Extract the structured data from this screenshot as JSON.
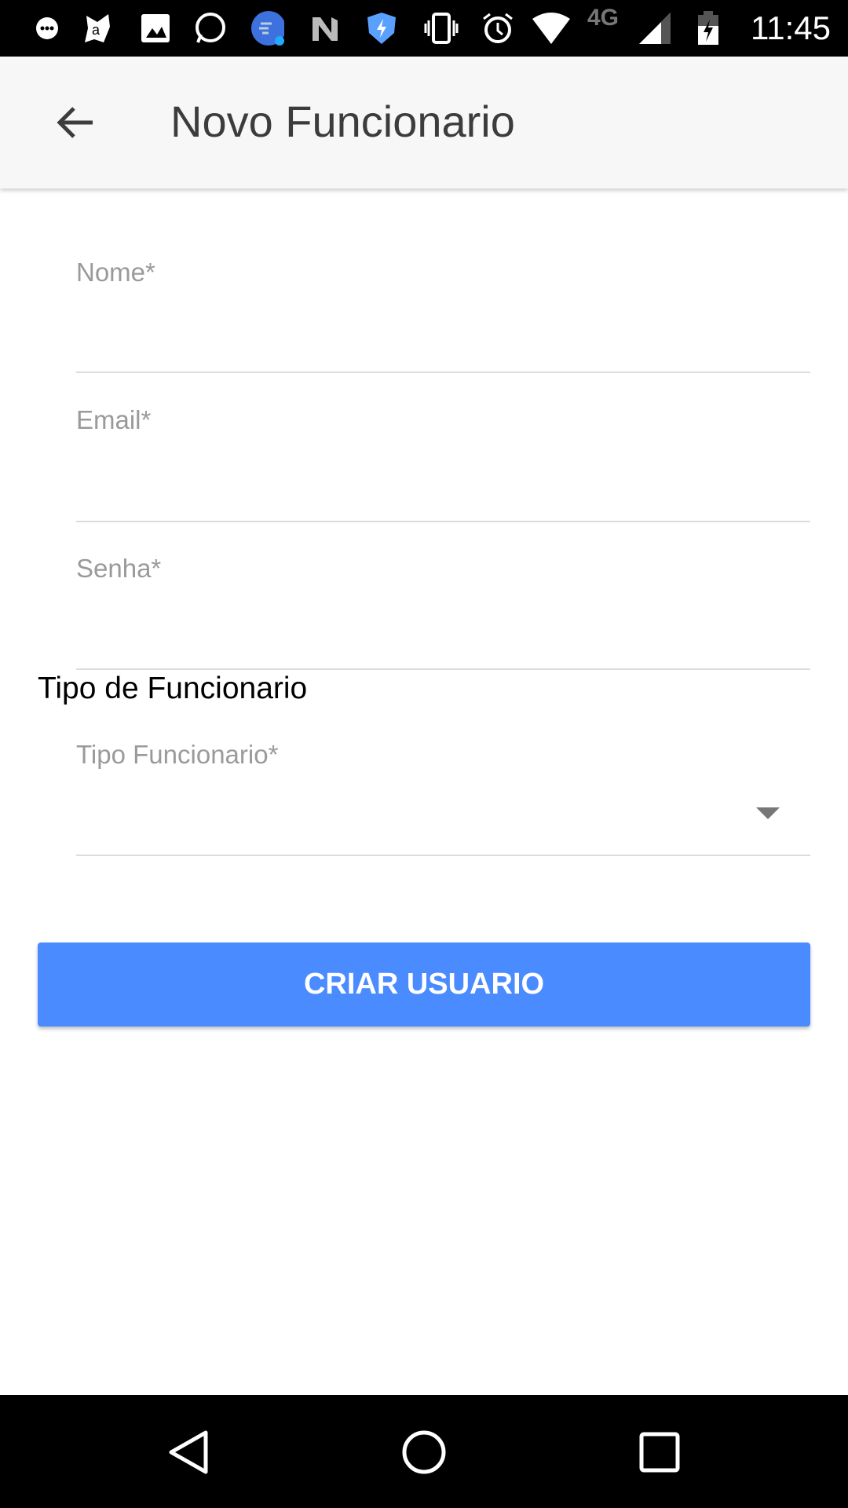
{
  "status_bar": {
    "time": "11:45",
    "network": "4G",
    "icons": [
      "chat-icon",
      "avast-icon",
      "image-icon",
      "whatsapp-icon",
      "cleaner-icon",
      "n-icon",
      "shield-bolt-icon",
      "vibrate-icon",
      "alarm-icon",
      "wifi-icon",
      "signal-icon",
      "battery-charging-icon"
    ]
  },
  "app_bar": {
    "title": "Novo Funcionario",
    "back_icon": "arrow-left-icon"
  },
  "form": {
    "name_label": "Nome*",
    "name_value": "",
    "email_label": "Email*",
    "email_value": "",
    "password_label": "Senha*",
    "password_value": "",
    "section_title": "Tipo de Funcionario",
    "type_label": "Tipo Funcionario*",
    "type_value": ""
  },
  "button": {
    "label": "CRIAR USUARIO",
    "color": "#4a8cff"
  },
  "nav_bar": {
    "icons": [
      "back-triangle-icon",
      "home-circle-icon",
      "recents-square-icon"
    ]
  }
}
